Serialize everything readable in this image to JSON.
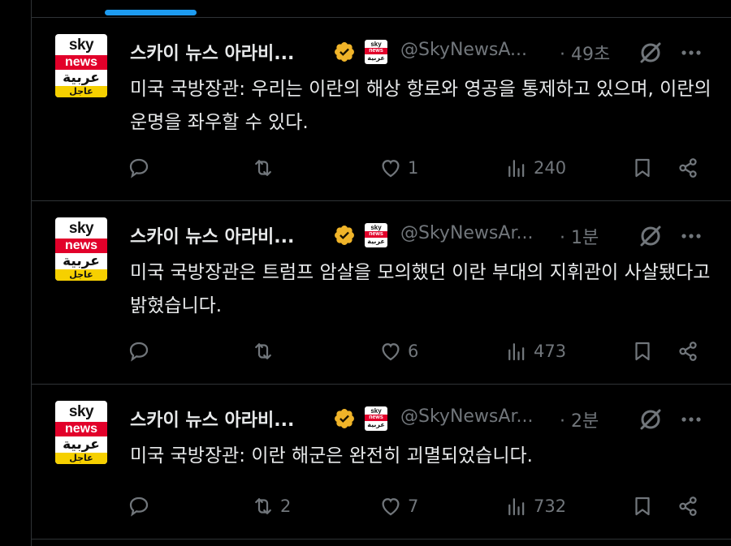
{
  "tab_indicator_color": "#1d9bf0",
  "accent_verified": "#f0b429",
  "tweets": [
    {
      "display_name": "스카이 뉴스 아라비...",
      "handle": "@SkyNewsA...",
      "time": "· 49초",
      "text": "미국 국방장관: 우리는 이란의 해상 항로와 영공을 통제하고 있으며, 이란의 운명을 좌우할 수 있다.",
      "replies": "",
      "retweets": "",
      "likes": "1",
      "views": "240",
      "avatar": {
        "sky": "sky",
        "news": "news",
        "arabic": "عربية",
        "urgent": "عاجل"
      }
    },
    {
      "display_name": "스카이 뉴스 아라비...",
      "handle": "@SkyNewsAr...",
      "time": "· 1분",
      "text": "미국 국방장관은 트럼프 암살을 모의했던 이란 부대의 지휘관이 사살됐다고 밝혔습니다.",
      "replies": "",
      "retweets": "",
      "likes": "6",
      "views": "473",
      "avatar": {
        "sky": "sky",
        "news": "news",
        "arabic": "عربية",
        "urgent": "عاجل"
      }
    },
    {
      "display_name": "스카이 뉴스 아라비...",
      "handle": "@SkyNewsAr...",
      "time": "· 2분",
      "text": "미국 국방장관: 이란 해군은 완전히 괴멸되었습니다.",
      "replies": "",
      "retweets": "2",
      "likes": "7",
      "views": "732",
      "avatar": {
        "sky": "sky",
        "news": "news",
        "arabic": "عربية",
        "urgent": "عاجل"
      }
    }
  ],
  "icons": [
    "reply-icon",
    "retweet-icon",
    "like-icon",
    "views-icon",
    "bookmark-icon",
    "share-icon",
    "verified-badge-icon",
    "grok-icon",
    "more-icon"
  ]
}
